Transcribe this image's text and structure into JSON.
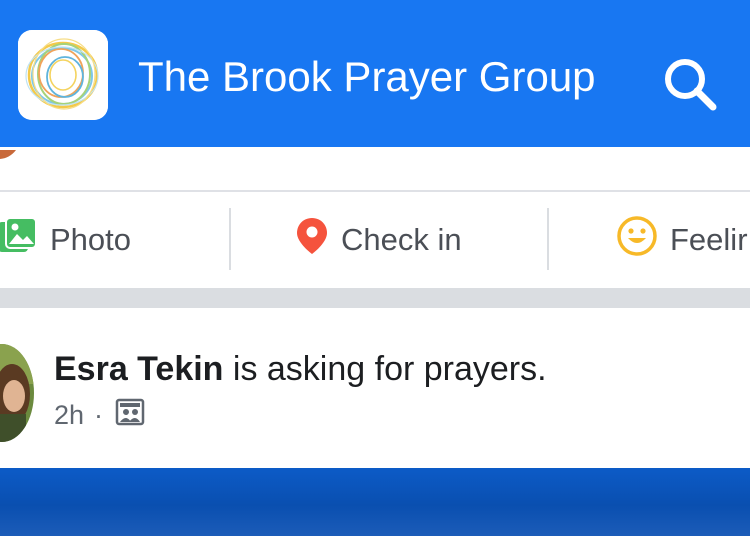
{
  "header": {
    "title": "The Brook Prayer Group",
    "logo_icon": "brook-ripple-logo",
    "search_icon": "search-icon",
    "background": "#1877f2"
  },
  "composer_actions": [
    {
      "label": "Photo",
      "icon": "photo-icon",
      "icon_color": "#45bd62"
    },
    {
      "label": "Check in",
      "icon": "location-pin-icon",
      "icon_color": "#f5533d"
    },
    {
      "label": "Feelir",
      "icon": "smiley-icon",
      "icon_color": "#f7b928"
    }
  ],
  "post": {
    "author": "Esra Tekin",
    "action_text": " is asking for prayers.",
    "time": "2h",
    "separator": "·",
    "audience_icon": "group-audience-icon"
  },
  "colors": {
    "brand_blue": "#1877f2",
    "text_primary": "#1c1e21",
    "text_secondary": "#606770"
  }
}
